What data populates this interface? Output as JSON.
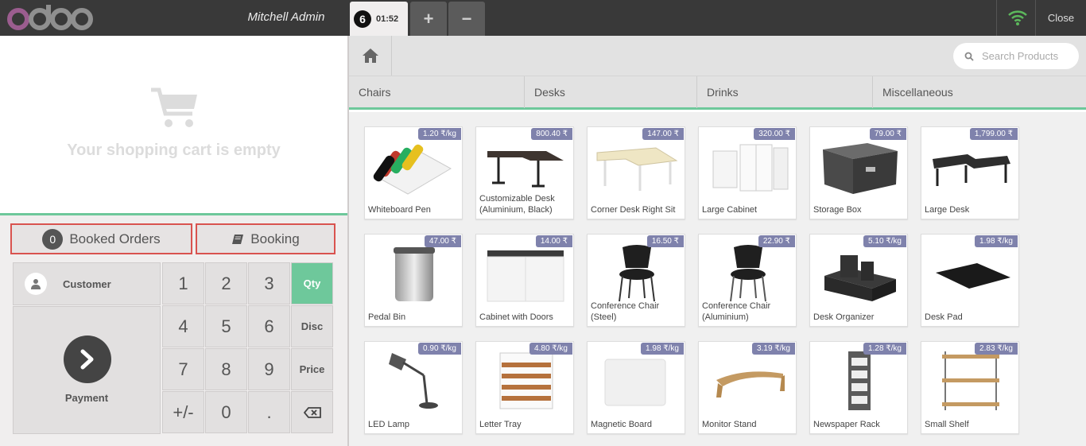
{
  "header": {
    "logo_text": "odoo",
    "user_name": "Mitchell Admin",
    "order_number": "6",
    "order_time": "01:52",
    "add_order": "+",
    "remove_order": "−",
    "close": "Close"
  },
  "cart": {
    "empty_text": "Your shopping cart is empty"
  },
  "extensions": {
    "booked_orders_count": "0",
    "booked_orders_label": "Booked Orders",
    "booking_label": "Booking"
  },
  "actionpad": {
    "customer_label": "Customer",
    "payment_label": "Payment"
  },
  "numpad": {
    "keys": [
      "1",
      "2",
      "3",
      "Qty",
      "4",
      "5",
      "6",
      "Disc",
      "7",
      "8",
      "9",
      "Price",
      "+/-",
      "0",
      ".",
      ""
    ],
    "active_mode": "Qty"
  },
  "search": {
    "placeholder": "Search Products"
  },
  "categories": [
    "Chairs",
    "Desks",
    "Drinks",
    "Miscellaneous"
  ],
  "products": [
    {
      "name": "Whiteboard Pen",
      "price": "1.20 ₹/kg"
    },
    {
      "name": "Customizable Desk (Aluminium, Black)",
      "price": "800.40 ₹"
    },
    {
      "name": "Corner Desk Right Sit",
      "price": "147.00 ₹"
    },
    {
      "name": "Large Cabinet",
      "price": "320.00 ₹"
    },
    {
      "name": "Storage Box",
      "price": "79.00 ₹"
    },
    {
      "name": "Large Desk",
      "price": "1,799.00 ₹"
    },
    {
      "name": "Pedal Bin",
      "price": "47.00 ₹"
    },
    {
      "name": "Cabinet with Doors",
      "price": "14.00 ₹"
    },
    {
      "name": "Conference Chair (Steel)",
      "price": "16.50 ₹"
    },
    {
      "name": "Conference Chair (Aluminium)",
      "price": "22.90 ₹"
    },
    {
      "name": "Desk Organizer",
      "price": "5.10 ₹/kg"
    },
    {
      "name": "Desk Pad",
      "price": "1.98 ₹/kg"
    },
    {
      "name": "LED Lamp",
      "price": "0.90 ₹/kg"
    },
    {
      "name": "Letter Tray",
      "price": "4.80 ₹/kg"
    },
    {
      "name": "Magnetic Board",
      "price": "1.98 ₹/kg"
    },
    {
      "name": "Monitor Stand",
      "price": "3.19 ₹/kg"
    },
    {
      "name": "Newspaper Rack",
      "price": "1.28 ₹/kg"
    },
    {
      "name": "Small Shelf",
      "price": "2.83 ₹/kg"
    }
  ],
  "colors": {
    "accent": "#6ec89b",
    "header_bg": "#393939",
    "price_tag": "#7f82ac",
    "highlight_border": "#d9534f",
    "wifi": "#5cb85c"
  }
}
